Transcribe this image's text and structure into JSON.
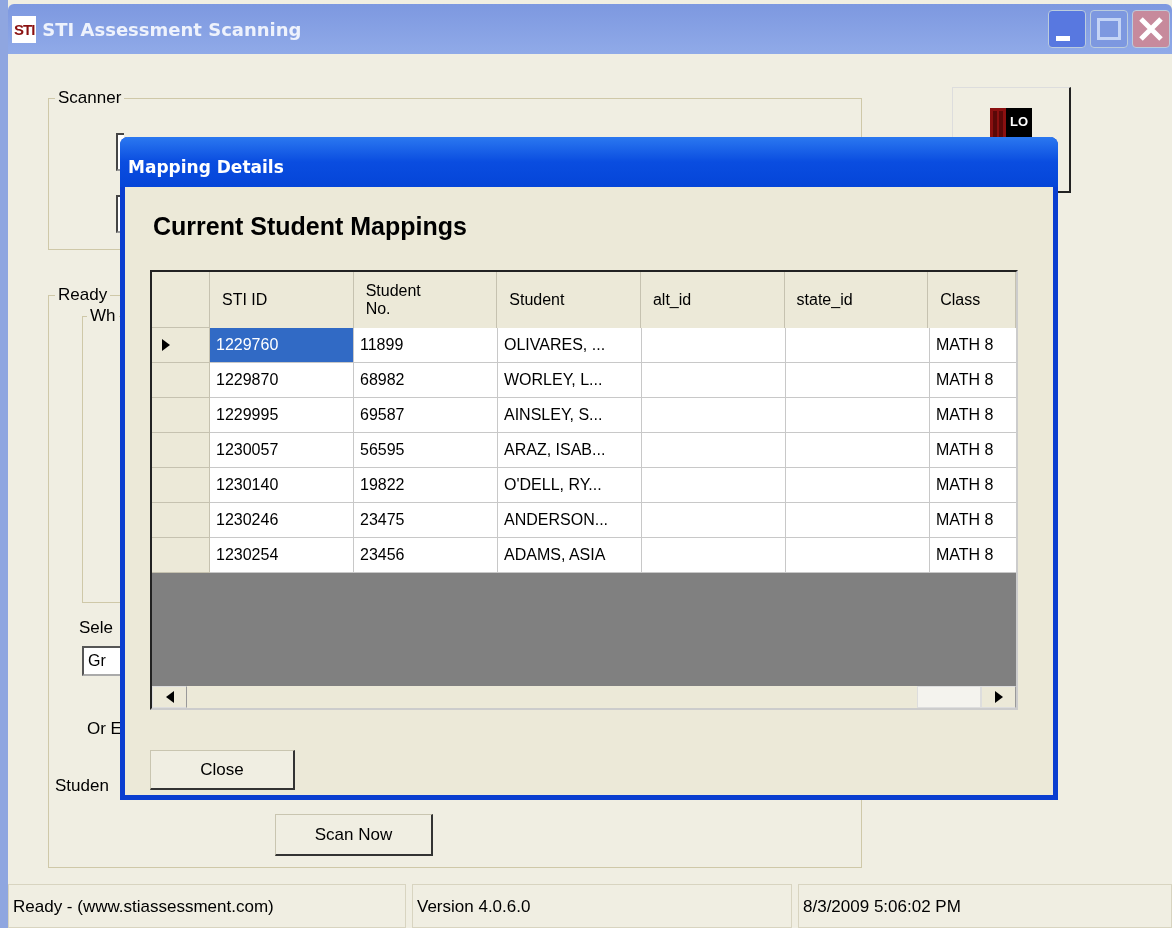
{
  "window": {
    "title": "STI Assessment Scanning",
    "app_logo": "STI"
  },
  "scanner_group": {
    "label": "Scanner"
  },
  "ready_group": {
    "label": "Ready",
    "inner_label": "Wh",
    "select_label": "Sele",
    "select_value": "Gr",
    "or_label": "Or E",
    "student_label": "Studen",
    "scan_button": "Scan Now"
  },
  "side_button": {
    "icon_text": "LO"
  },
  "dialog": {
    "title": "Mapping Details",
    "heading": "Current Student Mappings",
    "table": {
      "columns": [
        "STI ID",
        "Student No.",
        "Student",
        "alt_id",
        "state_id",
        "Class"
      ],
      "rows": [
        {
          "selected": true,
          "cells": [
            "1229760",
            "11899",
            "OLIVARES, ...",
            "",
            "",
            "MATH 8"
          ]
        },
        {
          "selected": false,
          "cells": [
            "1229870",
            "68982",
            "WORLEY, L...",
            "",
            "",
            "MATH 8"
          ]
        },
        {
          "selected": false,
          "cells": [
            "1229995",
            "69587",
            "AINSLEY, S...",
            "",
            "",
            "MATH 8"
          ]
        },
        {
          "selected": false,
          "cells": [
            "1230057",
            "56595",
            "ARAZ, ISAB...",
            "",
            "",
            "MATH 8"
          ]
        },
        {
          "selected": false,
          "cells": [
            "1230140",
            "19822",
            "O'DELL, RY...",
            "",
            "",
            "MATH 8"
          ]
        },
        {
          "selected": false,
          "cells": [
            "1230246",
            "23475",
            "ANDERSON...",
            "",
            "",
            "MATH 8"
          ]
        },
        {
          "selected": false,
          "cells": [
            "1230254",
            "23456",
            "ADAMS, ASIA",
            "",
            "",
            "MATH 8"
          ]
        }
      ]
    },
    "close_button": "Close"
  },
  "status_bar": [
    "Ready - (www.stiassessment.com)",
    "Version 4.0.6.0",
    "8/3/2009 5:06:02 PM"
  ]
}
